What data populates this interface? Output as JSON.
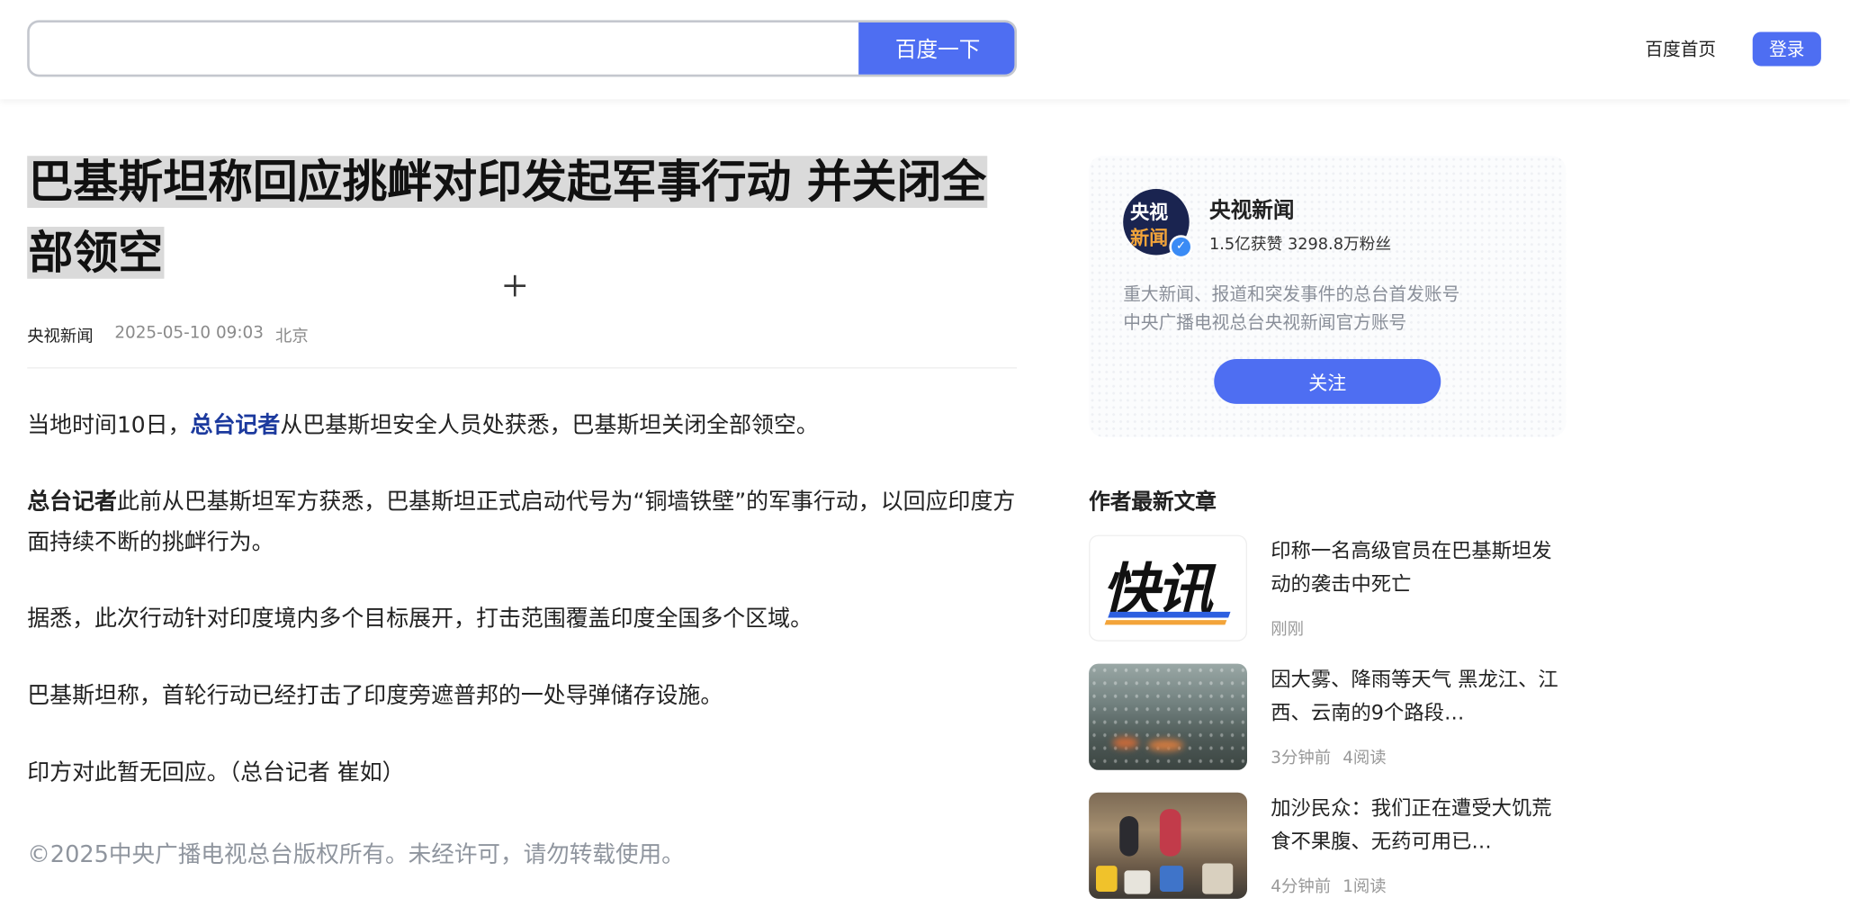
{
  "header": {
    "search_value": "",
    "search_button": "百度一下",
    "home_link": "百度首页",
    "login_button": "登录"
  },
  "article": {
    "title": "巴基斯坦称回应挑衅对印发起军事行动 并关闭全部领空",
    "source": "央视新闻",
    "time": "2025-05-10 09:03",
    "location": "北京",
    "p1_a": "当地时间10日，",
    "p1_link": "总台记者",
    "p1_b": "从巴基斯坦安全人员处获悉，巴基斯坦关闭全部领空。",
    "p2_bold": "总台记者",
    "p2_b": "此前从巴基斯坦军方获悉，巴基斯坦正式启动代号为“铜墙铁壁”的军事行动，以回应印度方面持续不断的挑衅行为。",
    "p3": "据悉，此次行动针对印度境内多个目标展开，打击范围覆盖印度全国多个区域。",
    "p4": "巴基斯坦称，首轮行动已经打击了印度旁遮普邦的一处导弹储存设施。",
    "p5": "印方对此暂无回应。（总台记者 崔如）",
    "copyright": "©2025中央广播电视总台版权所有。未经许可，请勿转载使用。"
  },
  "author": {
    "avatar_line1": "央视",
    "avatar_line2": "新闻",
    "name": "央视新闻",
    "stats": "1.5亿获赞 3298.8万粉丝",
    "desc_line1": "重大新闻、报道和突发事件的总台首发账号",
    "desc_line2": "中央广播电视总台央视新闻官方账号",
    "follow_button": "关注"
  },
  "latest": {
    "heading": "作者最新文章",
    "items": [
      {
        "title": "印称一名高级官员在巴基斯坦发动的袭击中死亡",
        "time": "刚刚",
        "reads": "",
        "thumb_text": "快讯"
      },
      {
        "title": "因大雾、降雨等天气 黑龙江、江西、云南的9个路段…",
        "time": "3分钟前",
        "reads": "4阅读"
      },
      {
        "title": "加沙民众：我们正在遭受大饥荒 食不果腹、无药可用已…",
        "time": "4分钟前",
        "reads": "1阅读"
      }
    ]
  }
}
